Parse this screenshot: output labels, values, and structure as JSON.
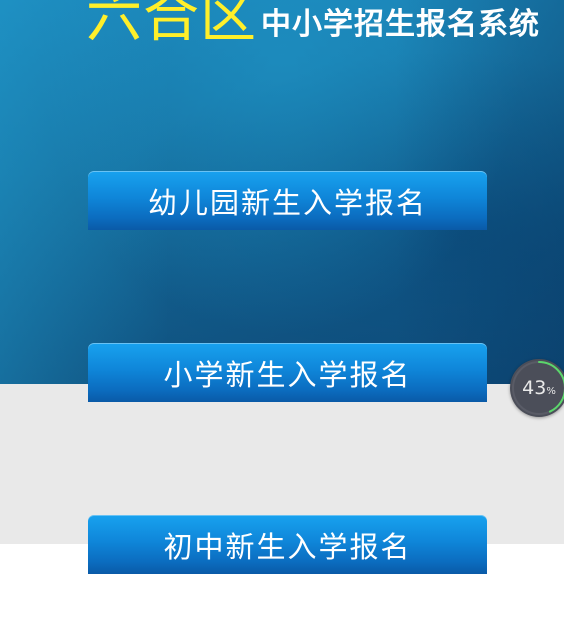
{
  "header": {
    "district": "六合区",
    "system_name": "中小学招生报名系统"
  },
  "buttons": {
    "kindergarten": "幼儿园新生入学报名",
    "primary": "小学新生入学报名",
    "junior_high": "初中新生入学报名"
  },
  "progress_widget": {
    "value": 43,
    "display_value": "43",
    "unit": "%",
    "ring_color": "#5bd66b"
  },
  "colors": {
    "title_yellow": "#ffef2a",
    "button_blue": "#0f86d9",
    "page_gray": "#e9e9e9"
  }
}
